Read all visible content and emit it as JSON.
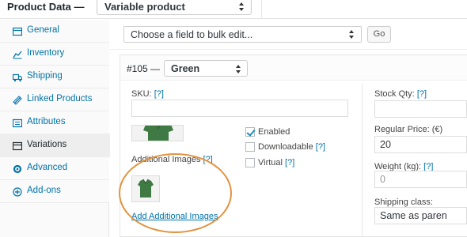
{
  "header": {
    "title": "Product Data —",
    "product_type": "Variable product"
  },
  "sidebar": {
    "items": [
      {
        "label": "General",
        "icon": "wrench-icon"
      },
      {
        "label": "Inventory",
        "icon": "chart-icon"
      },
      {
        "label": "Shipping",
        "icon": "truck-icon"
      },
      {
        "label": "Linked Products",
        "icon": "link-icon"
      },
      {
        "label": "Attributes",
        "icon": "list-icon"
      },
      {
        "label": "Variations",
        "icon": "grid-icon",
        "active": true
      },
      {
        "label": "Advanced",
        "icon": "gear-icon"
      },
      {
        "label": "Add-ons",
        "icon": "plus-circle-icon"
      }
    ]
  },
  "toolbar": {
    "bulk_placeholder": "Choose a field to bulk edit...",
    "go_label": "Go"
  },
  "variation": {
    "id_label": "#105 —",
    "attribute_value": "Green",
    "sku_label": "SKU:",
    "help_marker": "[?]",
    "additional_images_label": "Additional Images",
    "add_images_link": "Add Additional Images",
    "options": [
      {
        "label": "Enabled",
        "checked": true,
        "help": false
      },
      {
        "label": "Downloadable",
        "checked": false,
        "help": true
      },
      {
        "label": "Virtual",
        "checked": false,
        "help": true
      }
    ],
    "stock_qty_label": "Stock Qty:",
    "regular_price_label": "Regular Price: (€)",
    "regular_price_value": "20",
    "weight_label": "Weight (kg):",
    "weight_placeholder": "0",
    "shipping_class_label": "Shipping class:",
    "shipping_class_value": "Same as paren"
  },
  "colors": {
    "link": "#0073aa",
    "highlight_ring": "#e2933f",
    "shirt_green": "#3f7a44"
  }
}
